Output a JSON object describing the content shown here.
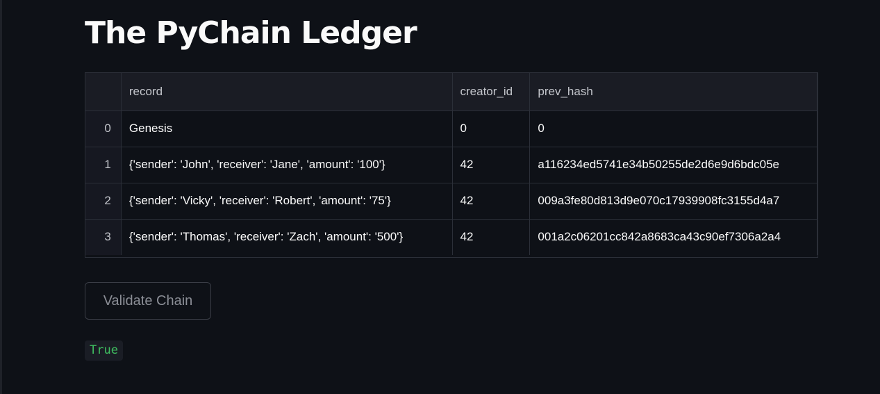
{
  "page": {
    "title": "The PyChain Ledger"
  },
  "table": {
    "columns": [
      "",
      "record",
      "creator_id",
      "prev_hash"
    ],
    "rows": [
      {
        "index": "0",
        "record": "Genesis",
        "creator_id": "0",
        "prev_hash": "0"
      },
      {
        "index": "1",
        "record": "{'sender': 'John', 'receiver': 'Jane', 'amount': '100'}",
        "creator_id": "42",
        "prev_hash": "a116234ed5741e34b50255de2d6e9d6bdc05e"
      },
      {
        "index": "2",
        "record": "{'sender': 'Vicky', 'receiver': 'Robert', 'amount': '75'}",
        "creator_id": "42",
        "prev_hash": "009a3fe80d813d9e070c17939908fc3155d4a7"
      },
      {
        "index": "3",
        "record": "{'sender': 'Thomas', 'receiver': 'Zach', 'amount': '500'}",
        "creator_id": "42",
        "prev_hash": "001a2c06201cc842a8683ca43c90ef7306a2a4"
      }
    ]
  },
  "validate": {
    "button_label": "Validate Chain",
    "result": "True"
  },
  "colors": {
    "background": "#0e1117",
    "header_bg": "#1a1c24",
    "result_text": "#3fbf60"
  }
}
